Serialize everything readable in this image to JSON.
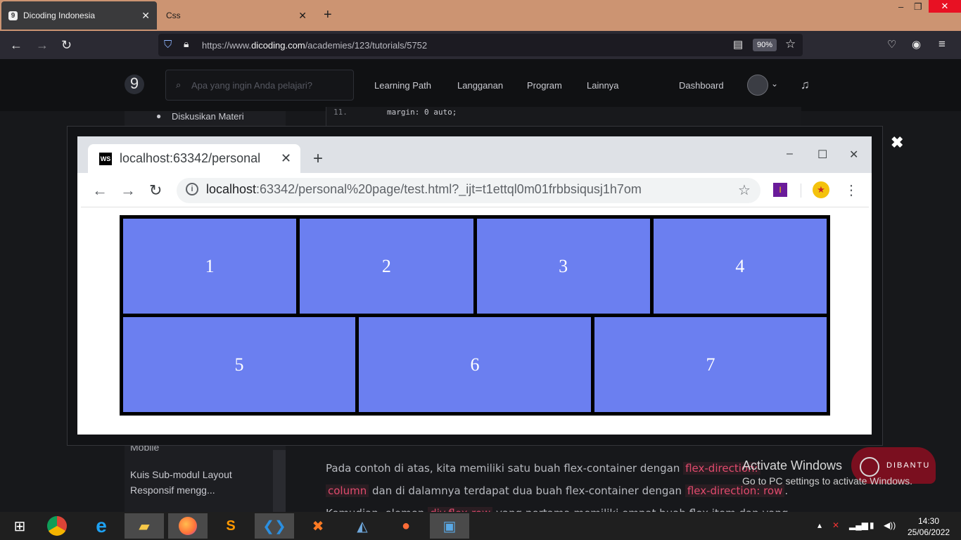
{
  "firefox": {
    "tabs": [
      {
        "label": "Dicoding Indonesia",
        "favicon": "9"
      },
      {
        "label": "Css"
      }
    ],
    "url_host": "https://www.",
    "url_domain": "dicoding.com",
    "url_path": "/academies/123/tutorials/5752",
    "zoom": "90%"
  },
  "site": {
    "logo": "9",
    "search_placeholder": "Apa yang ingin Anda pelajari?",
    "menu": [
      "Learning Path",
      "Langganan",
      "Program",
      "Lainnya"
    ],
    "dashboard": "Dashboard",
    "sidebar_discussion": "Diskusikan Materi",
    "sidebar_mobile": "Mobile",
    "sidebar_quiz": "Kuis Sub-modul Layout Responsif mengg...",
    "code_line_no": "11.",
    "code_line": "margin: 0 auto;"
  },
  "inner_browser": {
    "tab_title": "localhost:63342/personal",
    "url_host": "localhost",
    "url_rest": ":63342/personal%20page/test.html?_ijt=t1ettql0m01frbbsiqusj1h7om",
    "ws_badge": "WS"
  },
  "flex_demo": {
    "row1": [
      "1",
      "2",
      "3",
      "4"
    ],
    "row2": [
      "5",
      "6",
      "7"
    ],
    "item_color": "#6b7ff0"
  },
  "article": {
    "p1_before": "Pada contoh di atas, kita memiliki satu buah flex-container dengan ",
    "p1_code1": "flex-direction:",
    "p1_code2": "column",
    "p1_mid": " dan di dalamnya terdapat dua buah flex-container dengan ",
    "p1_code3": "flex-direction: row",
    "p1_end": ".",
    "p2_before": "Kemudian, elemen ",
    "p2_code": "div.flex-row",
    "p2_after": " yang pertama memiliki empat buah flex item dan yang"
  },
  "windows": {
    "activate_title": "Activate Windows",
    "activate_sub": "Go to PC settings to activate Windows.",
    "dibantu": "DIBANTU",
    "time": "14:30",
    "date": "25/06/2022"
  }
}
